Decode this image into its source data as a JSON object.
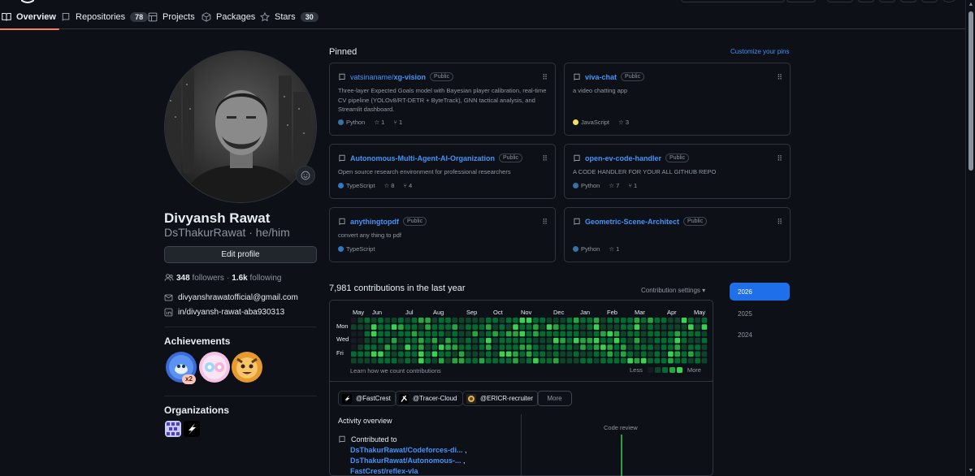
{
  "nav": {
    "tabs": [
      {
        "label": "Overview",
        "icon": "book-icon",
        "active": true
      },
      {
        "label": "Repositories",
        "icon": "repo-icon",
        "count": "78"
      },
      {
        "label": "Projects",
        "icon": "table-icon"
      },
      {
        "label": "Packages",
        "icon": "package-icon"
      },
      {
        "label": "Stars",
        "icon": "star-icon",
        "count": "30"
      }
    ]
  },
  "profile": {
    "name": "Divyansh Rawat",
    "login_line": "DsThakurRawat · he/him",
    "edit_label": "Edit profile",
    "followers_count": "348",
    "followers_label": "followers",
    "dot": "·",
    "following_count": "1.6k",
    "following_label": "following",
    "email": "divyanshrawatofficial@gmail.com",
    "linkedin": "in/divyansh-rawat-aba930313"
  },
  "achievements": {
    "heading": "Achievements",
    "multiplier": "x2"
  },
  "organizations": {
    "heading": "Organizations"
  },
  "pinned": {
    "heading": "Pinned",
    "customize": "Customize your pins",
    "public_label": "Public",
    "cards": [
      {
        "owner": "vatsinaname/",
        "repo": "xg-vision",
        "desc": "Three-layer Expected Goals model with Bayesian player calibration, real-time CV pipeline (YOLOv8/RT-DETR + ByteTrack), GNN tactical analysis, and Streamlit dashboard.",
        "lang": "Python",
        "lang_color": "#3572A5",
        "stars": "1",
        "forks": "1"
      },
      {
        "owner": "",
        "repo": "viva-chat",
        "desc": "a video chatting app",
        "lang": "JavaScript",
        "lang_color": "#f1e05a",
        "stars": "3",
        "forks": ""
      },
      {
        "owner": "",
        "repo": "Autonomous-Multi-Agent-AI-Organization",
        "desc": "Open source research environment for professional researchers",
        "lang": "TypeScript",
        "lang_color": "#3178c6",
        "stars": "8",
        "forks": "4"
      },
      {
        "owner": "",
        "repo": "open-ev-code-handler",
        "desc": "A CODE HANDLER FOR YOUR ALL GITHUB REPO",
        "lang": "Python",
        "lang_color": "#3572A5",
        "stars": "7",
        "forks": "1"
      },
      {
        "owner": "",
        "repo": "anythingtopdf",
        "desc": "convert any thing to pdf",
        "lang": "TypeScript",
        "lang_color": "#3178c6",
        "stars": "",
        "forks": ""
      },
      {
        "owner": "",
        "repo": "Geometric-Scene-Architect",
        "desc": "",
        "lang": "Python",
        "lang_color": "#3572A5",
        "stars": "1",
        "forks": ""
      }
    ]
  },
  "contributions": {
    "heading": "7,981 contributions in the last year",
    "settings": "Contribution settings ▾",
    "years": [
      "2026",
      "2025",
      "2024"
    ],
    "active_year": "2026",
    "months": [
      "May",
      "Jun",
      "Jul",
      "Aug",
      "Sep",
      "Oct",
      "Nov",
      "Dec",
      "Jan",
      "Feb",
      "Mar",
      "Apr",
      "May"
    ],
    "days": [
      "Mon",
      "Wed",
      "Fri"
    ],
    "learn": "Learn how we count contributions",
    "less": "Less",
    "more": "More",
    "level_colors": [
      "#161b22",
      "#0e4429",
      "#006d32",
      "#26a641",
      "#39d353"
    ]
  },
  "activity": {
    "orgs": [
      "@FastCrest",
      "@Tracer-Cloud",
      "@ERICR-recruiter"
    ],
    "more_label": "More",
    "heading": "Activity overview",
    "contributed_label": "Contributed to",
    "repos": [
      "DsThakurRawat/Codeforces-di...",
      "DsThakurRawat/Autonomous-...",
      "FastCrest/reflex-vla"
    ],
    "code_review": "Code review"
  }
}
